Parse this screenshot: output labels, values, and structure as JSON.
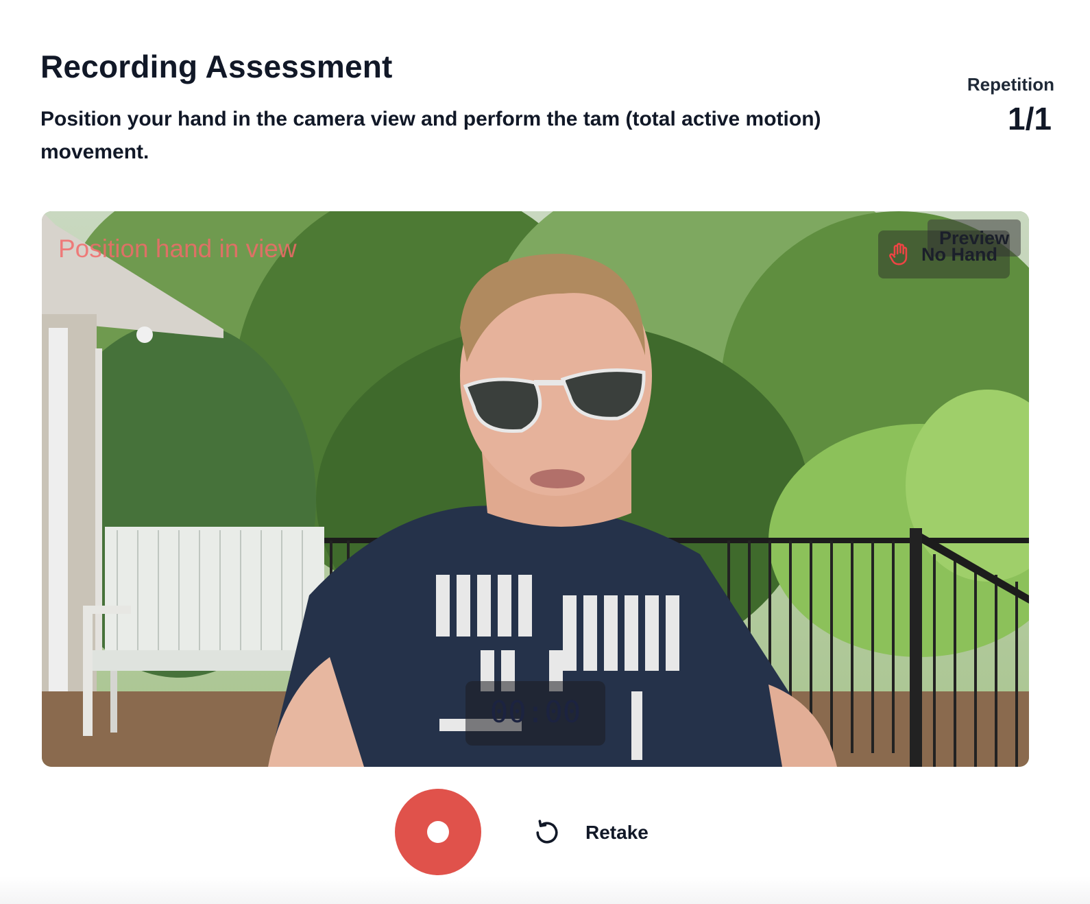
{
  "header": {
    "title": "Recording Assessment",
    "instructions": "Position your hand in the camera view and perform the tam (total active motion) movement."
  },
  "repetition": {
    "label": "Repetition",
    "count": "1/1"
  },
  "camera": {
    "hint_text": "Position hand in view",
    "preview_label": "Preview",
    "hand_status": "No Hand",
    "timer": "00:00"
  },
  "controls": {
    "retake_label": "Retake"
  },
  "colors": {
    "record_button": "#e0524b",
    "hint_text": "#f26a6a",
    "heading": "#111827"
  }
}
